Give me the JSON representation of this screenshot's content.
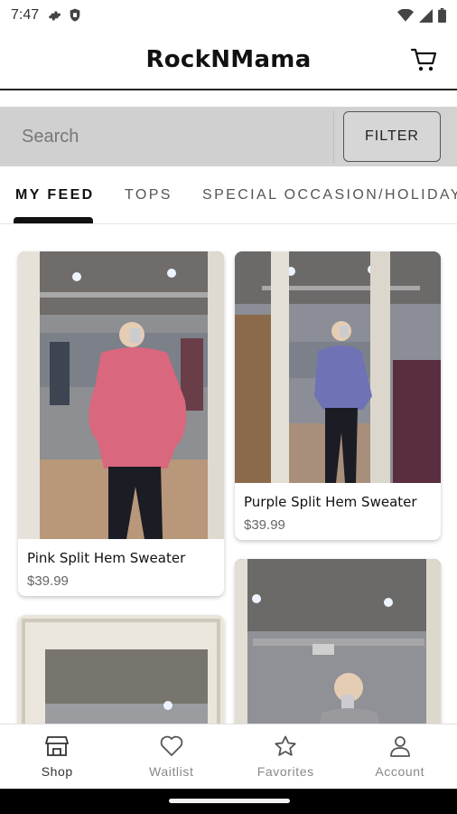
{
  "status_bar": {
    "time": "7:47",
    "left_icons": [
      "gear-icon",
      "shield-icon"
    ],
    "right_icons": [
      "wifi-icon",
      "signal-icon",
      "battery-icon"
    ]
  },
  "header": {
    "title": "RockNMama",
    "cart_icon": "cart-icon"
  },
  "search": {
    "placeholder": "Search",
    "filter_label": "FILTER"
  },
  "tabs": [
    {
      "label": "MY FEED",
      "active": true
    },
    {
      "label": "TOPS",
      "active": false
    },
    {
      "label": "SPECIAL OCCASION/HOLIDAY",
      "active": false
    }
  ],
  "products": [
    {
      "name": "Pink Split Hem Sweater",
      "price": "$39.99",
      "color": "#d9677d"
    },
    {
      "name": "Purple Split Hem Sweater",
      "price": "$39.99",
      "color": "#6f72b4"
    },
    {
      "name": "",
      "price": ""
    },
    {
      "name": "",
      "price": ""
    }
  ],
  "bottom_nav": [
    {
      "label": "Shop",
      "icon": "shop-icon",
      "active": true
    },
    {
      "label": "Waitlist",
      "icon": "heart-icon",
      "active": false
    },
    {
      "label": "Favorites",
      "icon": "star-icon",
      "active": false
    },
    {
      "label": "Account",
      "icon": "person-icon",
      "active": false
    }
  ]
}
